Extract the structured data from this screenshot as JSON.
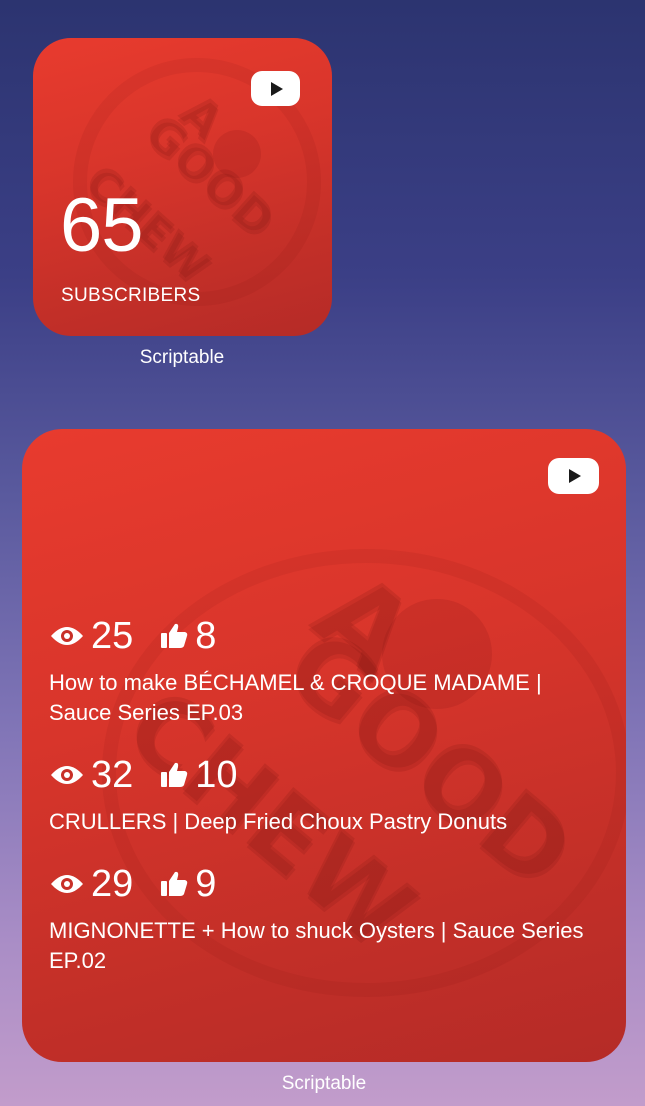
{
  "small_widget": {
    "subscriber_count": "65",
    "subscriber_label": "SUBSCRIBERS",
    "app_label": "Scriptable",
    "icon": "youtube-icon",
    "watermark": [
      "A",
      "GOOD",
      "CHEW"
    ]
  },
  "large_widget": {
    "app_label": "Scriptable",
    "icon": "youtube-icon",
    "watermark": [
      "A",
      "GOOD",
      "CHEW"
    ],
    "videos": [
      {
        "views": "25",
        "likes": "8",
        "title": "How to make BÉCHAMEL & CROQUE MADAME | Sauce Series EP.03"
      },
      {
        "views": "32",
        "likes": "10",
        "title": "CRULLERS | Deep Fried Choux Pastry Donuts"
      },
      {
        "views": "29",
        "likes": "9",
        "title": "MIGNONETTE + How to shuck Oysters | Sauce Series EP.02"
      }
    ]
  },
  "colors": {
    "widget_red": "#d8352b",
    "text": "#ffffff"
  }
}
